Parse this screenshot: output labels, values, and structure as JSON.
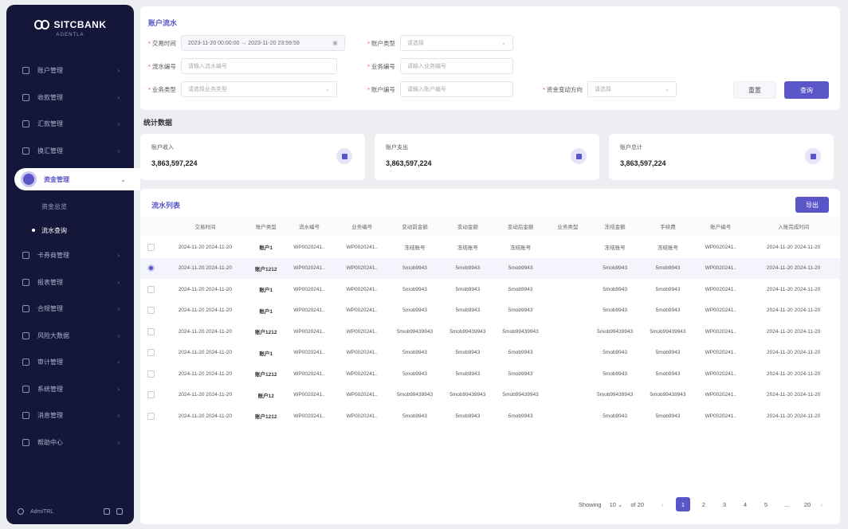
{
  "brand": {
    "name": "SITCBANK",
    "tagline": "AGENTLA"
  },
  "sidebar": {
    "items": [
      {
        "label": "账户管理",
        "chevron": "›"
      },
      {
        "label": "收款管理",
        "chevron": "›"
      },
      {
        "label": "汇款管理",
        "chevron": "›"
      },
      {
        "label": "换汇管理",
        "chevron": "›"
      },
      {
        "label": "资金管理",
        "chevron": "⌄"
      }
    ],
    "sub_items": [
      {
        "label": "资金总览"
      },
      {
        "label": "流水查询"
      }
    ],
    "items_after": [
      {
        "label": "卡券商管理",
        "chevron": "›"
      },
      {
        "label": "报表管理",
        "chevron": "›"
      },
      {
        "label": "合规管理",
        "chevron": "›"
      },
      {
        "label": "风险大数据",
        "chevron": "›"
      },
      {
        "label": "审计管理",
        "chevron": "›"
      },
      {
        "label": "系统管理",
        "chevron": "›"
      },
      {
        "label": "消息管理",
        "chevron": "›"
      },
      {
        "label": "帮助中心",
        "chevron": "›"
      }
    ],
    "footer_user": "AdmiTRL"
  },
  "filter": {
    "title": "账户流水",
    "time_label": "交易时间",
    "time_value": "2023-11-20 00:00:00  →  2023-11-20 23:59:59",
    "type_label": "账户类型",
    "type_placeholder": "请选择",
    "flow_label": "流水编号",
    "flow_placeholder": "请输入流水编号",
    "biz_label": "业务编号",
    "biz_placeholder": "请输入业务编号",
    "biztype_label": "业务类型",
    "biztype_placeholder": "请选择业务类型",
    "acct_label": "账户编号",
    "acct_placeholder": "请输入账户编号",
    "direction_label": "资金变动方向",
    "direction_placeholder": "请选择",
    "reset_label": "重置",
    "query_label": "查询"
  },
  "stats": {
    "title": "统计数据",
    "cards": [
      {
        "label": "账户收入",
        "value": "3,863,597,224"
      },
      {
        "label": "账户支出",
        "value": "3,863,597,224"
      },
      {
        "label": "账户总计",
        "value": "3,863,597,224"
      }
    ]
  },
  "table": {
    "title": "流水列表",
    "export_label": "导出",
    "columns": [
      "交易时间",
      "账户类型",
      "流水编号",
      "业务编号",
      "变动前金额",
      "变动金额",
      "变动后金额",
      "业务类型",
      "冻结金额",
      "手续费",
      "账户编号",
      "入账完成时间"
    ],
    "rows": [
      {
        "checked": false,
        "cells": [
          "2024-11-20 2024-11-20",
          "账户1",
          "WP0020241..",
          "WP0020241..",
          "冻结账号",
          "冻结账号",
          "冻结账号",
          "",
          "冻结账号",
          "冻结账号",
          "WP0020241..",
          "2024-11-20 2024-11-20"
        ]
      },
      {
        "checked": true,
        "cells": [
          "2024-11-20 2024-11-20",
          "账户1212",
          "WP0020241..",
          "WP0020241..",
          "5mob9943",
          "5mob9943",
          "5mob9943",
          "",
          "5mob9943",
          "5mob9943",
          "WP0020241..",
          "2024-11-20 2024-11-20"
        ]
      },
      {
        "checked": false,
        "cells": [
          "2024-11-20 2024-11-20",
          "账户1",
          "WP0020241..",
          "WP0020241..",
          "5mob9943",
          "5mob9943",
          "5mob9943",
          "",
          "5mob9943",
          "5mob9943",
          "WP0020241..",
          "2024-11-20 2024-11-20"
        ]
      },
      {
        "checked": false,
        "cells": [
          "2024-11-20 2024-11-20",
          "账户1",
          "WP0020241..",
          "WP0020241..",
          "5mob9943",
          "5mob9943",
          "5mob9943",
          "",
          "5mob9943",
          "5mob9943",
          "WP0020241..",
          "2024-11-20 2024-11-20"
        ]
      },
      {
        "checked": false,
        "cells": [
          "2024-11-20 2024-11-20",
          "账户1212",
          "WP0020241..",
          "WP0020241..",
          "5mob99439943",
          "5mob99439943",
          "5mob99439943",
          "",
          "5mob99439943",
          "5mob99439943",
          "WP0020241..",
          "2024-11-20 2024-11-20"
        ]
      },
      {
        "checked": false,
        "cells": [
          "2024-11-20 2024-11-20",
          "账户1",
          "WP0020241..",
          "WP0020241..",
          "5mob9943",
          "5mob9943",
          "5mob9943",
          "",
          "5mob9943",
          "5mob9943",
          "WP0020241..",
          "2024-11-20 2024-11-20"
        ]
      },
      {
        "checked": false,
        "cells": [
          "2024-11-20 2024-11-20",
          "账户1212",
          "WP0020241..",
          "WP0020241..",
          "5mob9943",
          "5mob9943",
          "5mob9943",
          "",
          "5mob9943",
          "5mob9943",
          "WP0020241..",
          "2024-11-20 2024-11-20"
        ]
      },
      {
        "checked": false,
        "cells": [
          "2024-11-20 2024-11-20",
          "账户12",
          "WP0020241..",
          "WP0020241..",
          "5mob99439943",
          "5mob99439943",
          "5mob99439943",
          "",
          "5mob99439943",
          "5mob99439943",
          "WP0020241..",
          "2024-11-20 2024-11-20"
        ]
      },
      {
        "checked": false,
        "cells": [
          "2024-11-20 2024-11-20",
          "账户1212",
          "WP0020241..",
          "WP0020241..",
          "5mob9943",
          "5mob9943",
          "5mob9943",
          "",
          "5mob9943",
          "5mob9943",
          "WP0020241..",
          "2024-11-20 2024-11-20"
        ]
      }
    ]
  },
  "pagination": {
    "showing_label": "Showing",
    "page_size": "10",
    "of_label": "of 20",
    "prev": "‹",
    "pages": [
      "1",
      "2",
      "3",
      "4",
      "5"
    ],
    "current_page": "1",
    "ellipsis": "...",
    "last_page": "20",
    "next": "›"
  },
  "colors": {
    "accent": "#5a56c8",
    "sidebar_bg": "#14163a",
    "page_bg": "#eceef2"
  }
}
